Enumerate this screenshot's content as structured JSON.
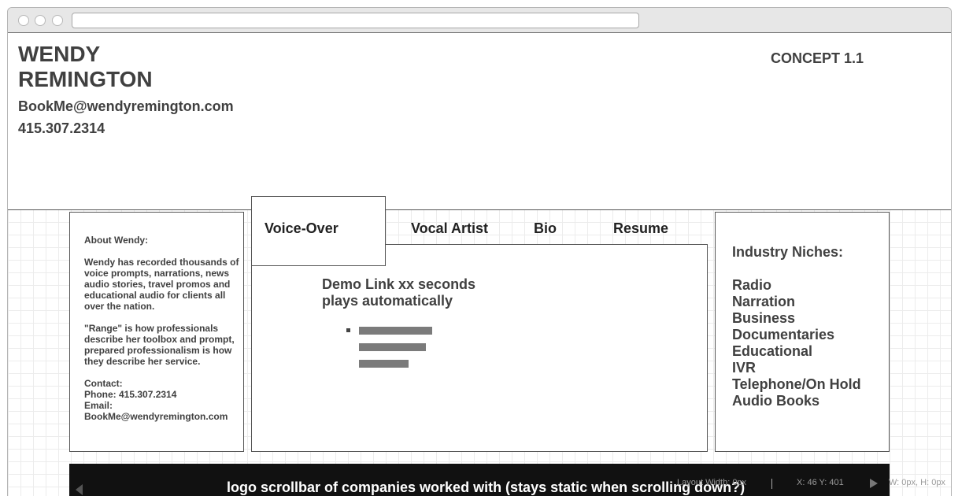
{
  "header": {
    "name_line1": "WENDY",
    "name_line2": "REMINGTON",
    "email": "BookMe@wendyremington.com",
    "phone": "415.307.2314",
    "concept": "CONCEPT 1.1"
  },
  "about": {
    "title": "About Wendy:",
    "paragraph1": "Wendy has recorded thousands of voice prompts, narrations, news audio stories, travel promos and educational audio for clients all over the nation.",
    "paragraph2": "\"Range\" is how professionals describe her toolbox and prompt, prepared professionalism is how they describe her service.",
    "contact_label": "Contact:",
    "contact_phone": "Phone: 415.307.2314",
    "contact_email_label": "Email:",
    "contact_email": "BookMe@wendyremington.com"
  },
  "nav": {
    "tabs": [
      {
        "label": "Voice-Over",
        "active": true
      },
      {
        "label": "Vocal Artist",
        "active": false
      },
      {
        "label": "Bio",
        "active": false
      },
      {
        "label": "Resume",
        "active": false
      }
    ]
  },
  "main": {
    "demo_line1": "Demo Link xx seconds",
    "demo_line2": "plays automatically"
  },
  "niches": {
    "title": "Industry Niches:",
    "items": [
      "Radio",
      "Narration",
      "Business",
      "Documentaries",
      "Educational",
      "IVR",
      "Telephone/On Hold",
      "Audio Books"
    ]
  },
  "footer": {
    "logo_bar_text": "logo scrollbar of companies worked with (stays static when scrolling down?)"
  },
  "status": {
    "overlay_text": "Layout Width: 0px",
    "coords": "X: 46 Y: 401",
    "size": "W: 0px, H: 0px"
  },
  "colors": {
    "text": "#404040",
    "logo_bar": "#111111",
    "placeholder_bar": "#7b7b7b"
  },
  "icons": [
    "window-close-dot",
    "window-minimize-dot",
    "window-maximize-dot",
    "chevron-left-icon",
    "play-icon"
  ]
}
